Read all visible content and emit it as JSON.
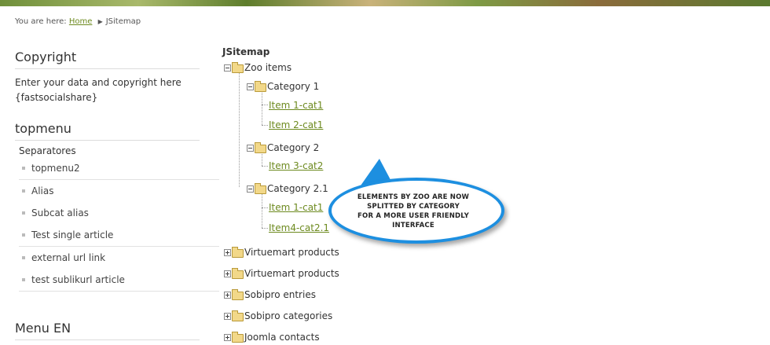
{
  "breadcrumb": {
    "prefix": "You are here:",
    "home": "Home",
    "current": "JSitemap"
  },
  "sidebar": {
    "copyright": {
      "title": "Copyright",
      "line1": "Enter your data and copyright here",
      "line2": "{fastsocialshare}"
    },
    "topmenu": {
      "title": "topmenu",
      "heading": "Separatores",
      "items": [
        "topmenu2",
        "Alias",
        "Subcat alias",
        "Test single article",
        "external url link",
        "test sublikurl article"
      ]
    },
    "menu_en": {
      "title": "Menu EN"
    }
  },
  "sitemap": {
    "title": "JSitemap",
    "zoo": {
      "label": "Zoo items",
      "categories": [
        {
          "label": "Category 1",
          "items": [
            "Item 1-cat1",
            "Item 2-cat1"
          ]
        },
        {
          "label": "Category 2",
          "items": [
            "Item 3-cat2"
          ]
        },
        {
          "label": "Category 2.1",
          "items": [
            "Item 1-cat1",
            "Item4-cat2.1"
          ]
        }
      ]
    },
    "collapsed": [
      "Virtuemart products",
      "Virtuemart products",
      "Sobipro entries",
      "Sobipro categories",
      "Joomla contacts"
    ]
  },
  "callout": {
    "line1": "ELEMENTS BY ZOO ARE NOW",
    "line2": "SPLITTED BY CATEGORY",
    "line3": "FOR A MORE USER FRIENDLY",
    "line4": "INTERFACE",
    "border_color": "#1d8fe0"
  },
  "colors": {
    "link": "#6d8a1f"
  }
}
